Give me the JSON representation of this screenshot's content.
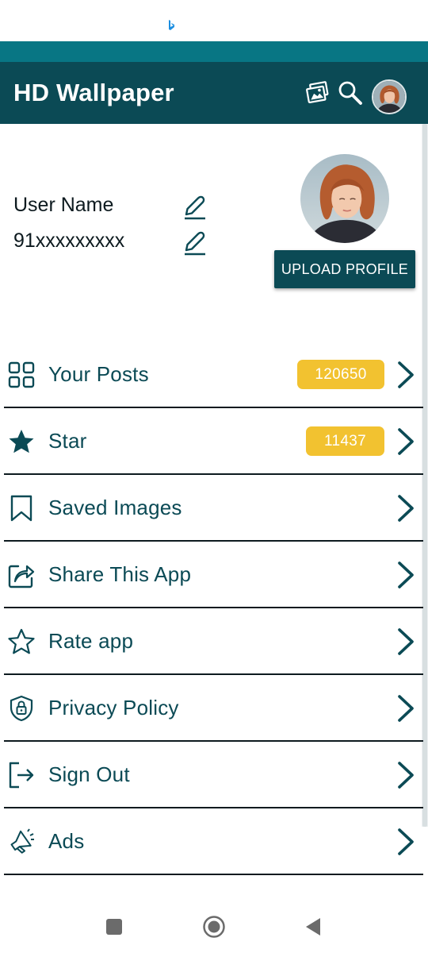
{
  "app": {
    "title": "HD Wallpaper"
  },
  "colors": {
    "primary": "#0b4a55",
    "strip": "#087684",
    "badge": "#f2c230",
    "text": "#0d1a1f"
  },
  "header_icons": [
    "gallery-icon",
    "search-icon",
    "avatar"
  ],
  "profile": {
    "user_name": "User Name",
    "phone": "91xxxxxxxxx",
    "upload_button": "UPLOAD PROFILE"
  },
  "menu": [
    {
      "label": "Your Posts",
      "icon": "grid-icon",
      "badge": "120650"
    },
    {
      "label": "Star",
      "icon": "star-filled-icon",
      "badge": "11437"
    },
    {
      "label": "Saved Images",
      "icon": "bookmark-icon"
    },
    {
      "label": "Share This App",
      "icon": "share-icon"
    },
    {
      "label": "Rate app",
      "icon": "star-outline-icon"
    },
    {
      "label": "Privacy Policy",
      "icon": "shield-lock-icon"
    },
    {
      "label": "Sign Out",
      "icon": "sign-out-icon"
    },
    {
      "label": "Ads",
      "icon": "megaphone-icon"
    }
  ],
  "system_nav": [
    "recents-icon",
    "home-icon",
    "back-icon"
  ]
}
